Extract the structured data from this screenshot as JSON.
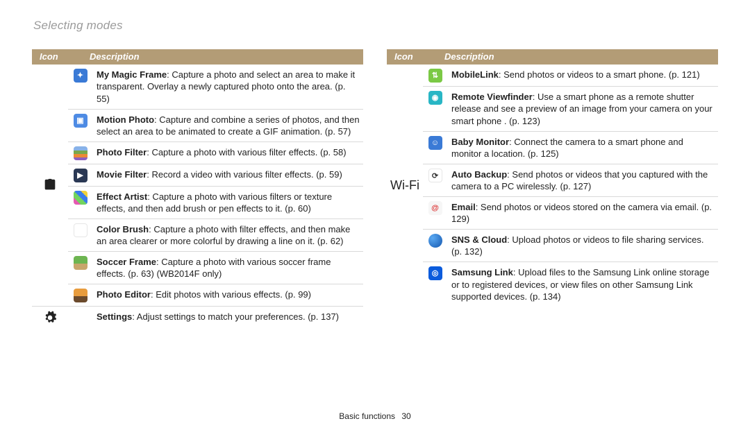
{
  "page_title": "Selecting modes",
  "headers": {
    "icon": "Icon",
    "desc": "Description"
  },
  "left": {
    "group_label": "magic",
    "items": [
      {
        "icon": "frame",
        "title": "My Magic Frame",
        "body": ": Capture a photo and select an area to make it transparent. Overlay a newly captured photo onto the area. (p. 55)"
      },
      {
        "icon": "motion",
        "title": "Motion Photo",
        "body": ": Capture and combine a series of photos, and then select an area to be animated to create a GIF animation. (p. 57)"
      },
      {
        "icon": "pfilter",
        "title": "Photo Filter",
        "body": ": Capture a photo with various filter effects. (p. 58)"
      },
      {
        "icon": "mfilter",
        "title": "Movie Filter",
        "body": ": Record a video with various filter effects. (p. 59)"
      },
      {
        "icon": "effect",
        "title": "Effect Artist",
        "body": ": Capture a photo with various filters or texture effects, and then add brush or pen effects to it. (p. 60)"
      },
      {
        "icon": "cbrush",
        "title": "Color Brush",
        "body": ": Capture a photo with filter effects, and then make an area clearer or more colorful by drawing a line on it. (p. 62)"
      },
      {
        "icon": "soccer",
        "title": "Soccer Frame",
        "body": ":  Capture a photo with various soccer frame effects. (p. 63) (WB2014F only)"
      },
      {
        "icon": "peditor",
        "title": "Photo Editor",
        "body": ": Edit photos with various effects. (p. 99)"
      }
    ],
    "settings": {
      "title": "Settings",
      "body": ": Adjust settings to match your preferences. (p. 137)"
    }
  },
  "right": {
    "group_label": "Wi-Fi",
    "items": [
      {
        "icon": "mlink",
        "title": "MobileLink",
        "body": ": Send photos or videos to a smart phone. (p. 121)"
      },
      {
        "icon": "rview",
        "title": "Remote Viewfinder",
        "body": ": Use a smart phone as a remote shutter release and see a preview of an image from your camera on your smart phone . (p. 123)"
      },
      {
        "icon": "bmon",
        "title": "Baby Monitor",
        "body": ": Connect the camera to a smart phone and monitor a location. (p. 125)"
      },
      {
        "icon": "abackup",
        "title": "Auto Backup",
        "body": ": Send photos or videos that you captured with the camera to a PC wirelessly. (p. 127)"
      },
      {
        "icon": "email",
        "title": "Email",
        "body": ": Send photos or videos stored on the camera via email. (p. 129)"
      },
      {
        "icon": "sns",
        "title": "SNS & Cloud",
        "body": ": Upload photos or videos to file sharing services. (p. 132)"
      },
      {
        "icon": "slink",
        "title": "Samsung Link",
        "body": ": Upload files to the Samsung Link online storage or to registered devices, or view files on other Samsung Link supported devices.  (p. 134)"
      }
    ]
  },
  "footer": {
    "section": "Basic functions",
    "page": "30"
  }
}
